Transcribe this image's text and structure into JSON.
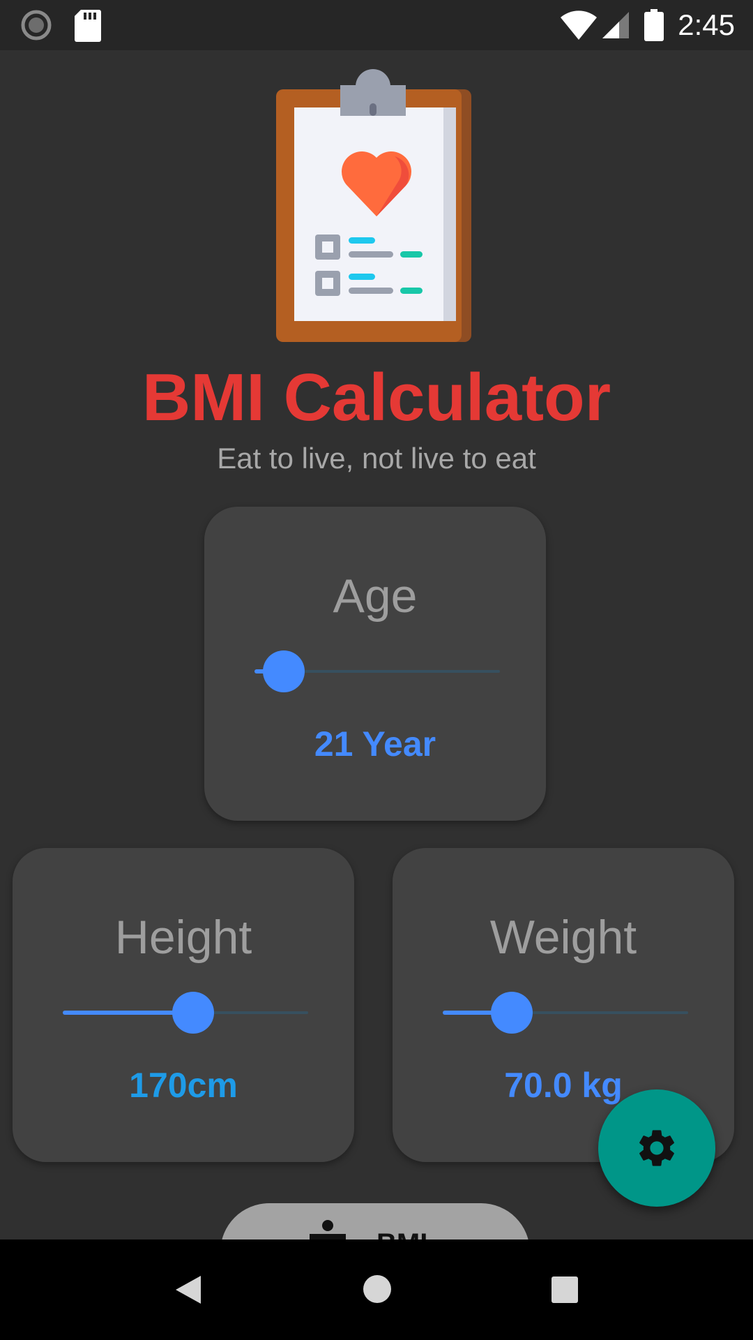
{
  "status_bar": {
    "time": "2:45",
    "icons": [
      "loading-indicator-icon",
      "sd-card-icon",
      "wifi-icon",
      "cell-signal-icon",
      "battery-icon"
    ]
  },
  "header": {
    "logo_icon": "clipboard-heart-icon",
    "title": "BMI Calculator",
    "subtitle": "Eat to live, not live to eat"
  },
  "age_card": {
    "label": "Age",
    "value_text": "21 Year",
    "slider_fraction": 0.12
  },
  "height_card": {
    "label": "Height",
    "value_text": "170cm",
    "slider_fraction": 0.53
  },
  "weight_card": {
    "label": "Weight",
    "value_text": "70.0 kg",
    "slider_fraction": 0.28
  },
  "fab": {
    "icon": "gear-icon"
  },
  "calculate_button": {
    "icon": "person-icon",
    "label": "BMI"
  },
  "nav_bar": {
    "icons": [
      "back-icon",
      "home-icon",
      "recent-apps-icon"
    ]
  },
  "colors": {
    "title": "#e53935",
    "accent_blue": "#448aff",
    "height_value": "#1e9be8",
    "fab": "#009688",
    "card": "#424242",
    "background": "#303030"
  }
}
